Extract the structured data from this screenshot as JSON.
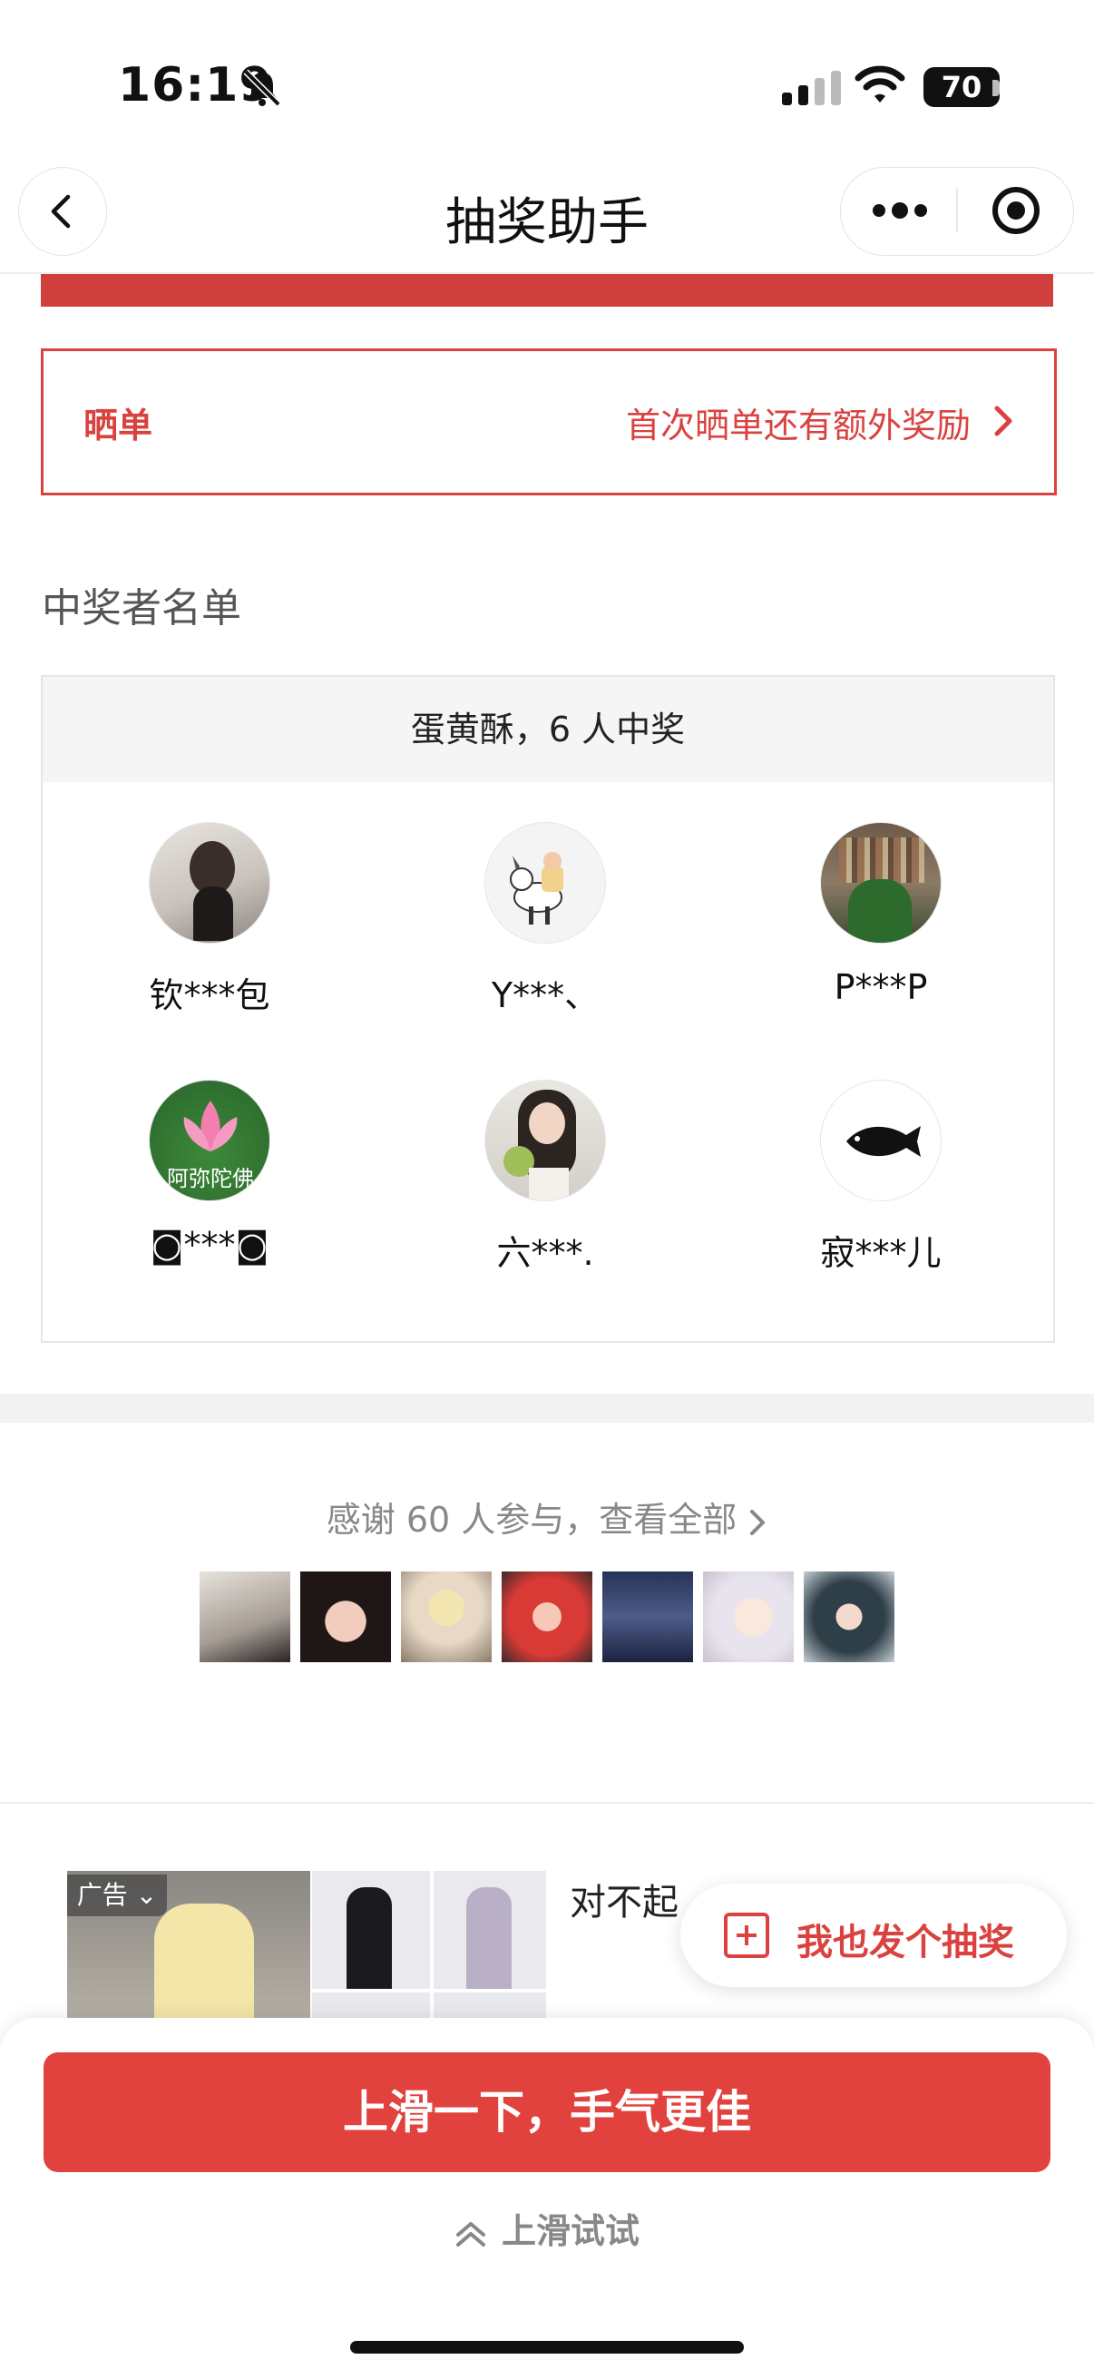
{
  "status_bar": {
    "time": "16:19",
    "battery": "70"
  },
  "nav": {
    "title": "抽奖助手"
  },
  "show_order": {
    "label": "晒单",
    "hint": "首次晒单还有额外奖励"
  },
  "winners": {
    "section_title": "中奖者名单",
    "header": "蛋黄酥，6 人中奖",
    "list": [
      {
        "name": "钦***包"
      },
      {
        "name": "Y***、"
      },
      {
        "name": "P***P"
      },
      {
        "name": "◙***◙"
      },
      {
        "name": "六***."
      },
      {
        "name": "寂***儿"
      }
    ],
    "avatar_lotus_caption": "阿弥陀佛"
  },
  "participants": {
    "text": "感谢 60 人参与，查看全部"
  },
  "ad": {
    "tag": "广告",
    "text": "对不起"
  },
  "float_button": {
    "label": "我也发个抽奖"
  },
  "bottom": {
    "main_button": "上滑一下，手气更佳",
    "hint": "上滑试试"
  },
  "colors": {
    "accent": "#e2423d",
    "accent_text": "#d9423f",
    "red_bar": "#cf3f3d"
  }
}
